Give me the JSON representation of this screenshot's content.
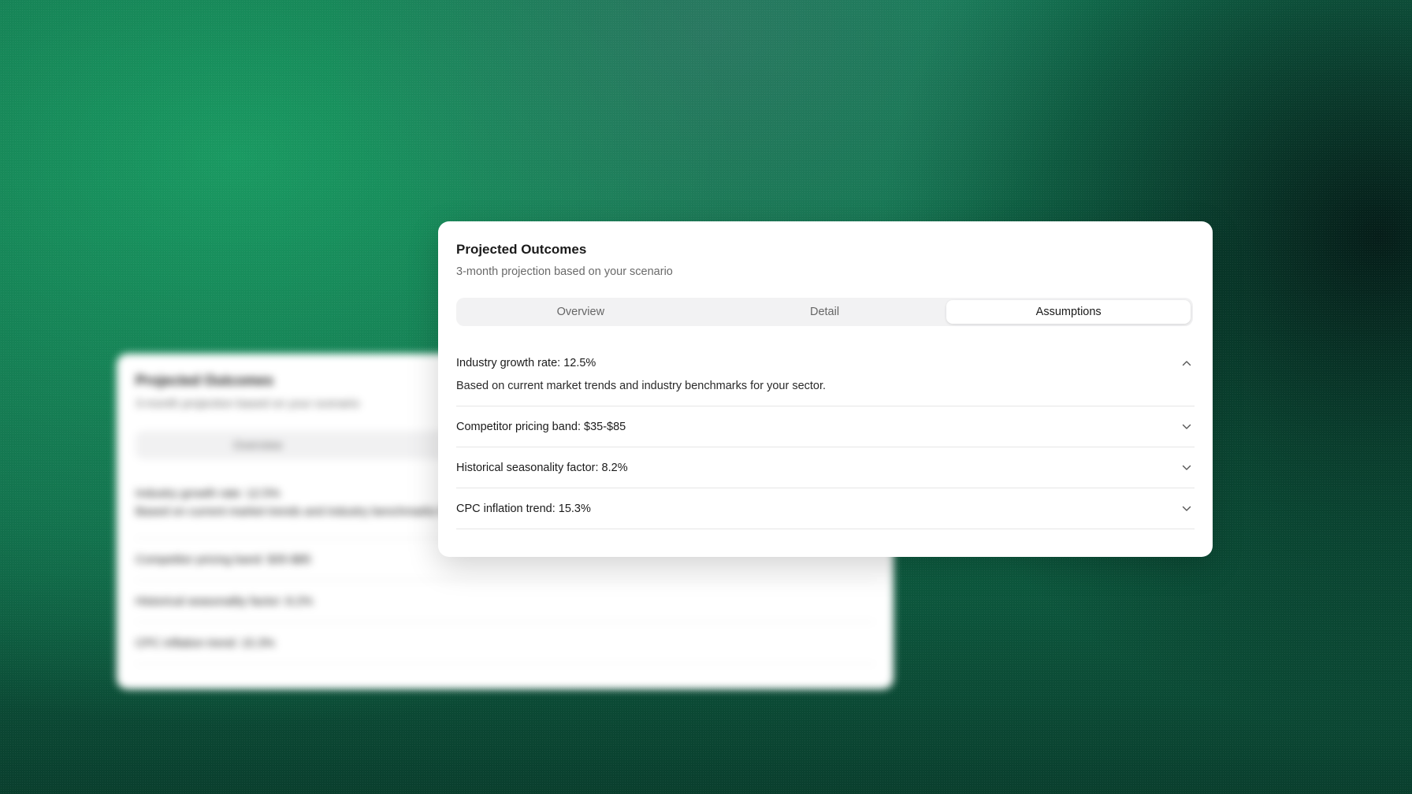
{
  "card": {
    "title": "Projected Outcomes",
    "subtitle": "3-month projection based on your scenario"
  },
  "tabs": [
    {
      "label": "Overview",
      "active": false
    },
    {
      "label": "Detail",
      "active": false
    },
    {
      "label": "Assumptions",
      "active": true
    }
  ],
  "assumptions": [
    {
      "label": "Industry growth rate: 12.5%",
      "expanded": true,
      "description": "Based on current market trends and industry benchmarks for your sector.",
      "icon": "chevron-up-icon"
    },
    {
      "label": "Competitor pricing band: $35-$85",
      "expanded": false,
      "icon": "chevron-down-icon"
    },
    {
      "label": "Historical seasonality factor: 8.2%",
      "expanded": false,
      "icon": "chevron-down-icon"
    },
    {
      "label": "CPC inflation trend: 15.3%",
      "expanded": false,
      "icon": "chevron-down-icon"
    }
  ],
  "colors": {
    "background_green": "#15805a",
    "card_bg": "#ffffff",
    "tab_track": "#f2f2f3"
  }
}
